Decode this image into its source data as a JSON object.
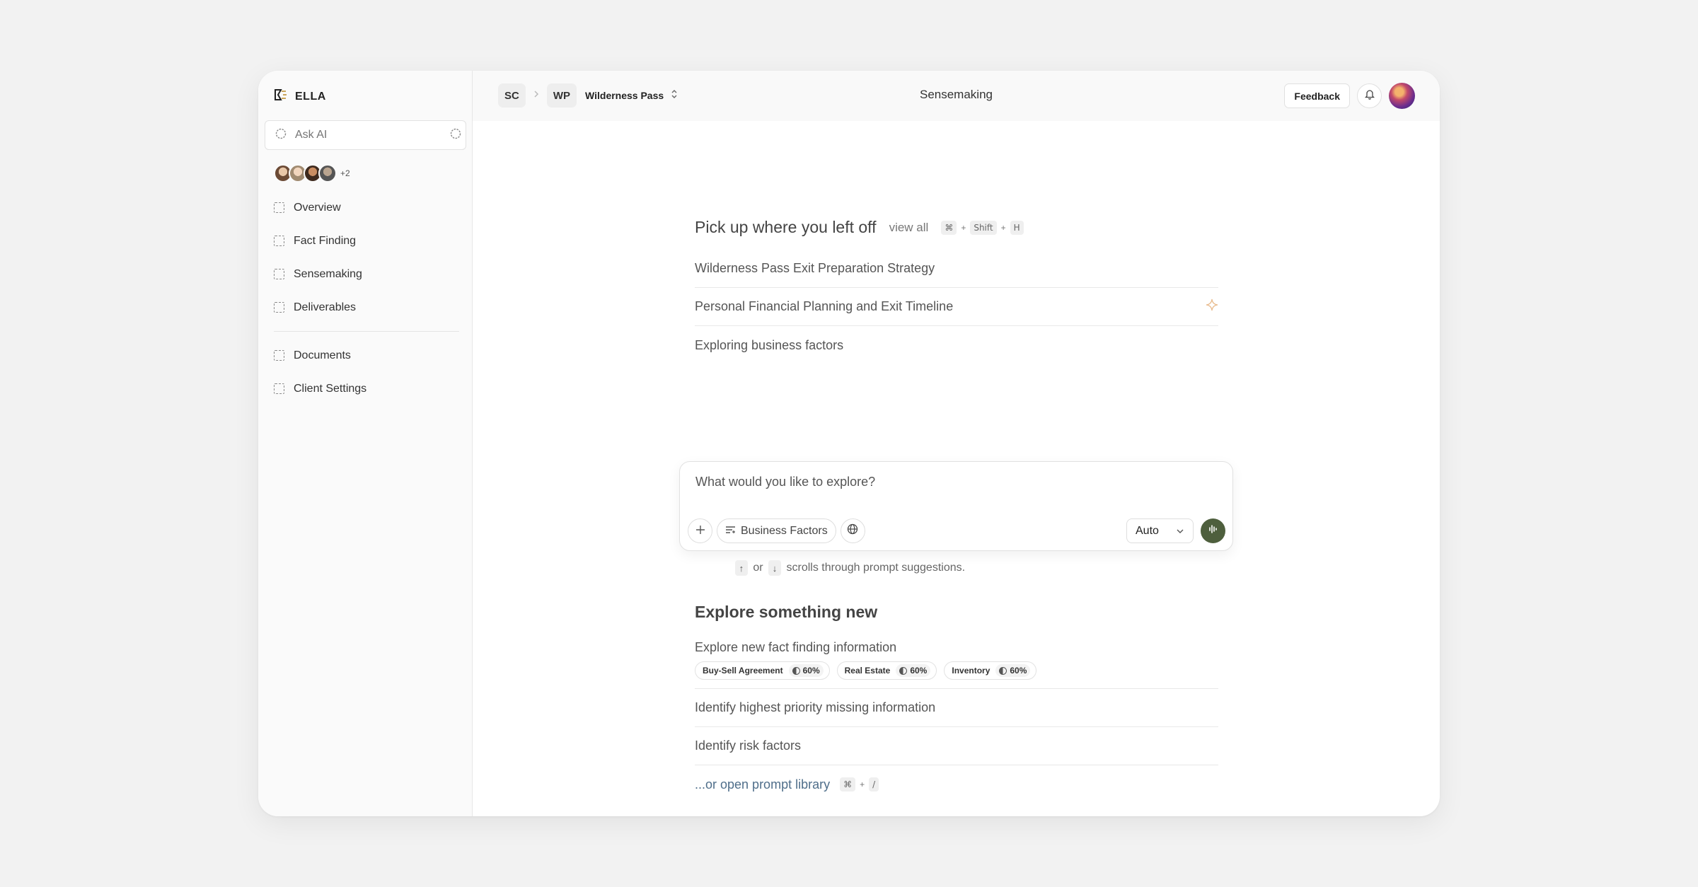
{
  "app": {
    "name": "ELLA"
  },
  "sidebar": {
    "ask_placeholder": "Ask AI",
    "collaborators_more": "+2",
    "items": [
      {
        "label": "Overview"
      },
      {
        "label": "Fact Finding"
      },
      {
        "label": "Sensemaking"
      },
      {
        "label": "Deliverables"
      },
      {
        "label": "Documents"
      },
      {
        "label": "Client Settings"
      }
    ]
  },
  "header": {
    "org_chip": "SC",
    "client_chip": "WP",
    "client_name": "Wilderness Pass",
    "title": "Sensemaking",
    "feedback_label": "Feedback"
  },
  "recent": {
    "title": "Pick up where you left off",
    "view_all": "view all",
    "shortcut": [
      "⌘",
      "+",
      "Shift",
      "+",
      "H"
    ],
    "items": [
      {
        "label": "Wilderness Pass Exit Preparation Strategy"
      },
      {
        "label": "Personal Financial Planning and Exit Timeline"
      },
      {
        "label": "Exploring business factors"
      }
    ]
  },
  "prompt": {
    "placeholder": "What would you like to explore?",
    "context_label": "Business Factors",
    "model": "Auto",
    "hint_or": "or",
    "hint_text": "scrolls through prompt suggestions."
  },
  "explore": {
    "title": "Explore something new",
    "fact_finding": {
      "label": "Explore new fact finding information",
      "tags": [
        {
          "name": "Buy-Sell Agreement",
          "pct": "60%"
        },
        {
          "name": "Real Estate",
          "pct": "60%"
        },
        {
          "name": "Inventory",
          "pct": "60%"
        }
      ]
    },
    "items": [
      {
        "label": "Identify highest priority missing information"
      },
      {
        "label": "Identify risk factors"
      }
    ],
    "library_label": "...or open prompt library",
    "library_shortcut": [
      "⌘",
      "+",
      "/"
    ]
  },
  "colors": {
    "accent": "#4e5f3d",
    "sparkle": "#e8b98a",
    "link": "#4f6e8a"
  }
}
